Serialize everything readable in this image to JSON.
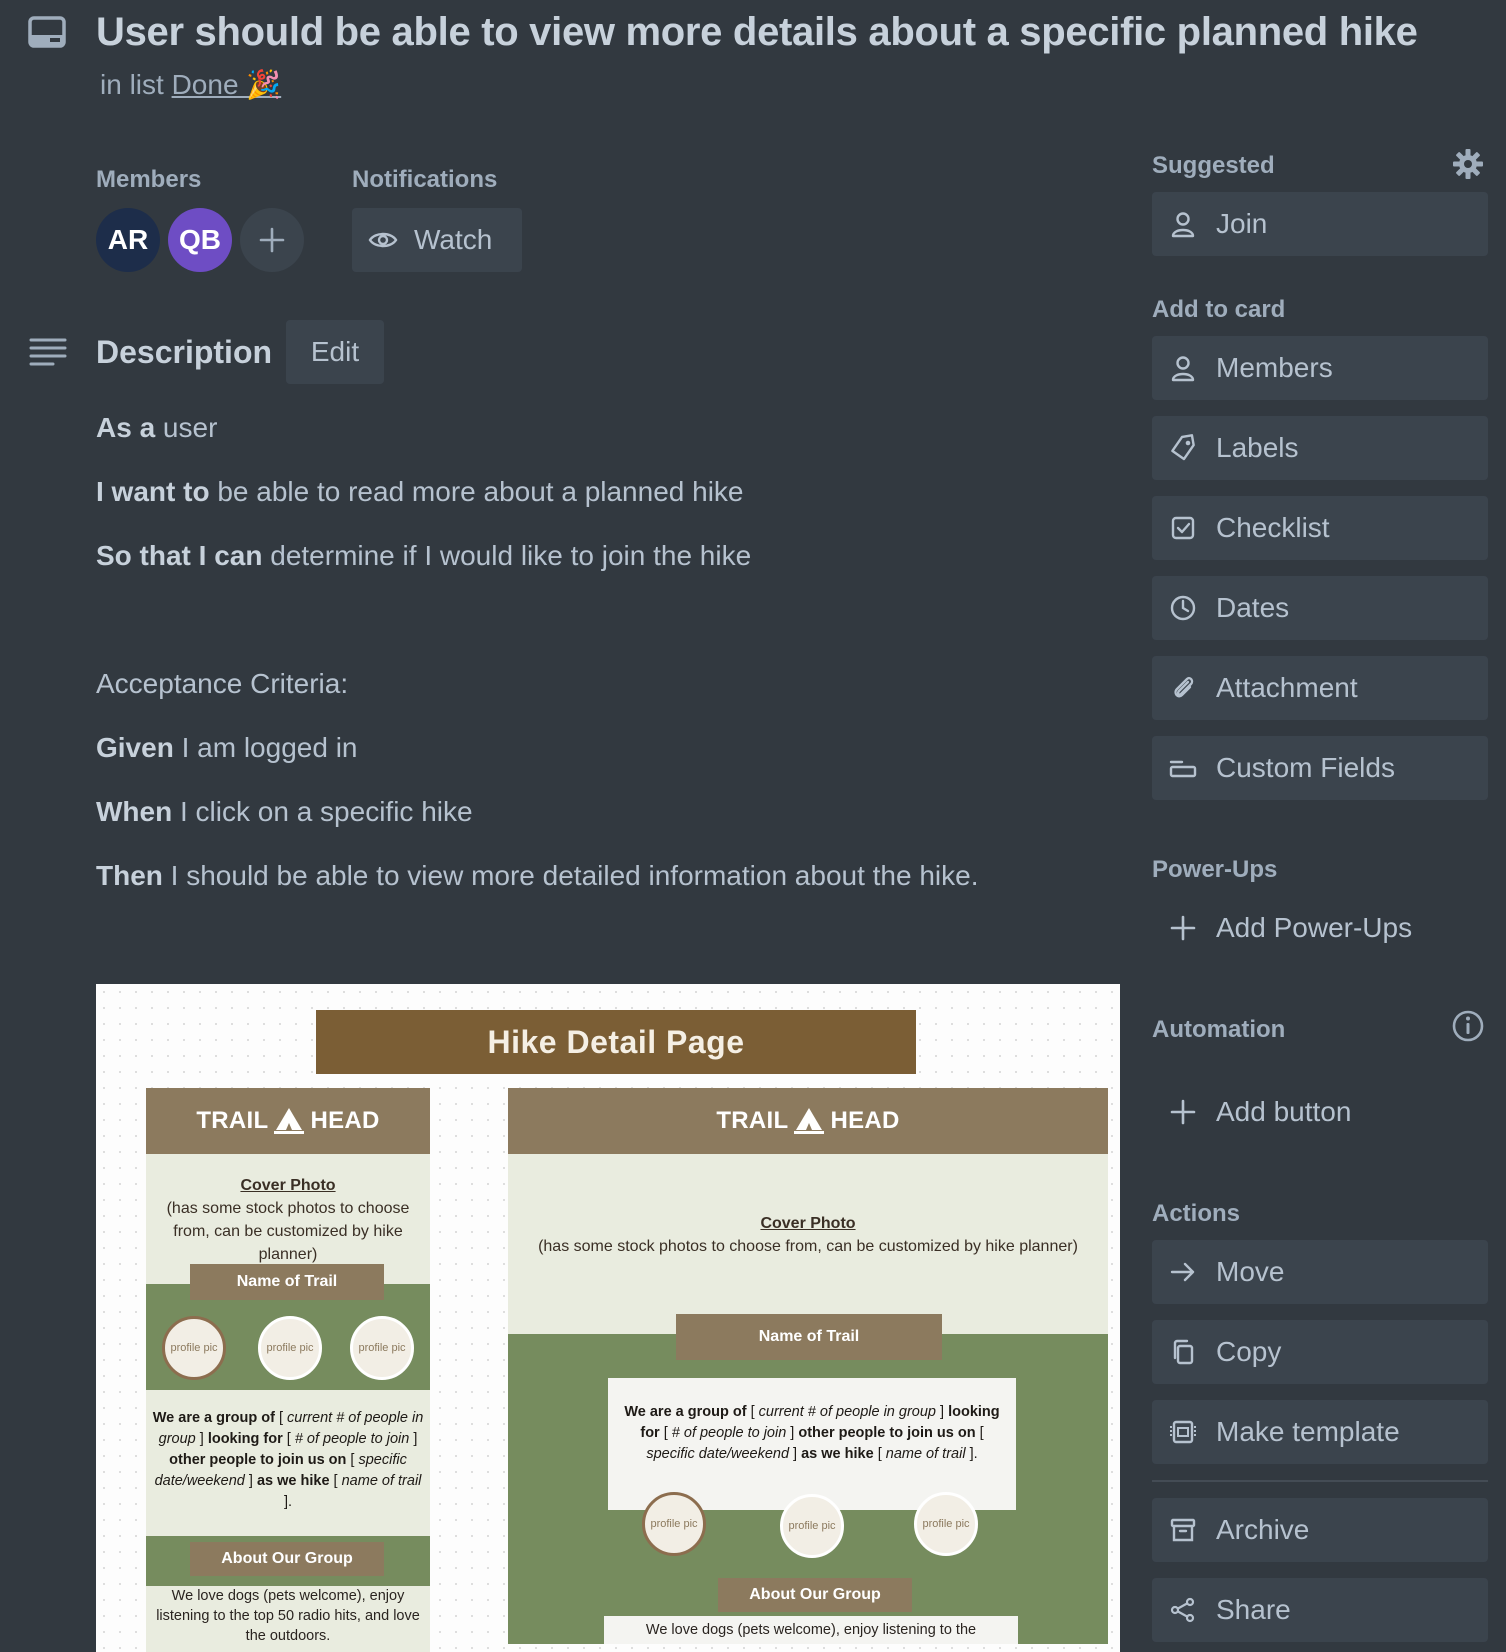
{
  "card": {
    "title": "User should be able to view more details about a specific planned hike",
    "in_list_prefix": "in list",
    "list_name": "Done 🎉"
  },
  "members": {
    "label": "Members",
    "avatars": [
      {
        "initials": "AR",
        "color": "#1d2d4a"
      },
      {
        "initials": "QB",
        "color": "#6e4dc4"
      }
    ]
  },
  "notifications": {
    "label": "Notifications",
    "watch_label": "Watch"
  },
  "description": {
    "title": "Description",
    "edit_label": "Edit",
    "lines": [
      {
        "bold": "As a",
        "text": " user"
      },
      {
        "bold": "I want to",
        "text": " be able to read more about a planned hike"
      },
      {
        "bold": "So that I can",
        "text": " determine if I would like to join the hike"
      },
      {
        "bold": "",
        "text": "Acceptance Criteria:"
      },
      {
        "bold": "Given",
        "text": " I am logged in"
      },
      {
        "bold": "When",
        "text": " I click on a specific hike"
      },
      {
        "bold": "Then",
        "text": " I should be able to view more detailed information about the hike."
      }
    ]
  },
  "mockup": {
    "banner": "Hike Detail Page",
    "brand_left": "TRAIL",
    "brand_right": "HEAD",
    "cover_title": "Cover Photo",
    "cover_desc": "(has some stock photos to choose from, can be customized by hike planner)",
    "trail_tag": "Name of Trail",
    "profile_pic": "profile pic",
    "group_parts": [
      {
        "t": "We are a group of ",
        "s": "b"
      },
      {
        "t": "[ ",
        "s": "n"
      },
      {
        "t": "current # of people in group",
        "s": "i"
      },
      {
        "t": " ] ",
        "s": "n"
      },
      {
        "t": "looking for ",
        "s": "b"
      },
      {
        "t": "[ ",
        "s": "n"
      },
      {
        "t": "# of people to join",
        "s": "i"
      },
      {
        "t": " ] ",
        "s": "n"
      },
      {
        "t": "other people to join us on ",
        "s": "b"
      },
      {
        "t": "[ ",
        "s": "n"
      },
      {
        "t": "specific date/weekend",
        "s": "i"
      },
      {
        "t": " ] ",
        "s": "n"
      },
      {
        "t": "as we hike ",
        "s": "b"
      },
      {
        "t": "[ ",
        "s": "n"
      },
      {
        "t": "name of trail",
        "s": "i"
      },
      {
        "t": " ].",
        "s": "n"
      }
    ],
    "about_tag": "About Our Group",
    "about_text_left": "We love dogs (pets welcome), enjoy listening to the top 50 radio hits, and love the outdoors.",
    "about_text_right": "We love dogs (pets welcome), enjoy listening to the"
  },
  "sidebar": {
    "suggested_label": "Suggested",
    "join_label": "Join",
    "add_to_card_label": "Add to card",
    "add_to_card": [
      {
        "label": "Members",
        "icon": "person-icon"
      },
      {
        "label": "Labels",
        "icon": "tag-icon"
      },
      {
        "label": "Checklist",
        "icon": "checklist-icon"
      },
      {
        "label": "Dates",
        "icon": "clock-icon"
      },
      {
        "label": "Attachment",
        "icon": "paperclip-icon"
      },
      {
        "label": "Custom Fields",
        "icon": "custom-fields-icon"
      }
    ],
    "powerups_label": "Power-Ups",
    "add_powerups_label": "Add Power-Ups",
    "automation_label": "Automation",
    "add_button_label": "Add button",
    "actions_label": "Actions",
    "actions": [
      {
        "label": "Move",
        "icon": "arrow-right-icon"
      },
      {
        "label": "Copy",
        "icon": "copy-icon"
      },
      {
        "label": "Make template",
        "icon": "template-icon"
      },
      {
        "label": "Archive",
        "icon": "archive-icon"
      },
      {
        "label": "Share",
        "icon": "share-icon"
      }
    ]
  }
}
